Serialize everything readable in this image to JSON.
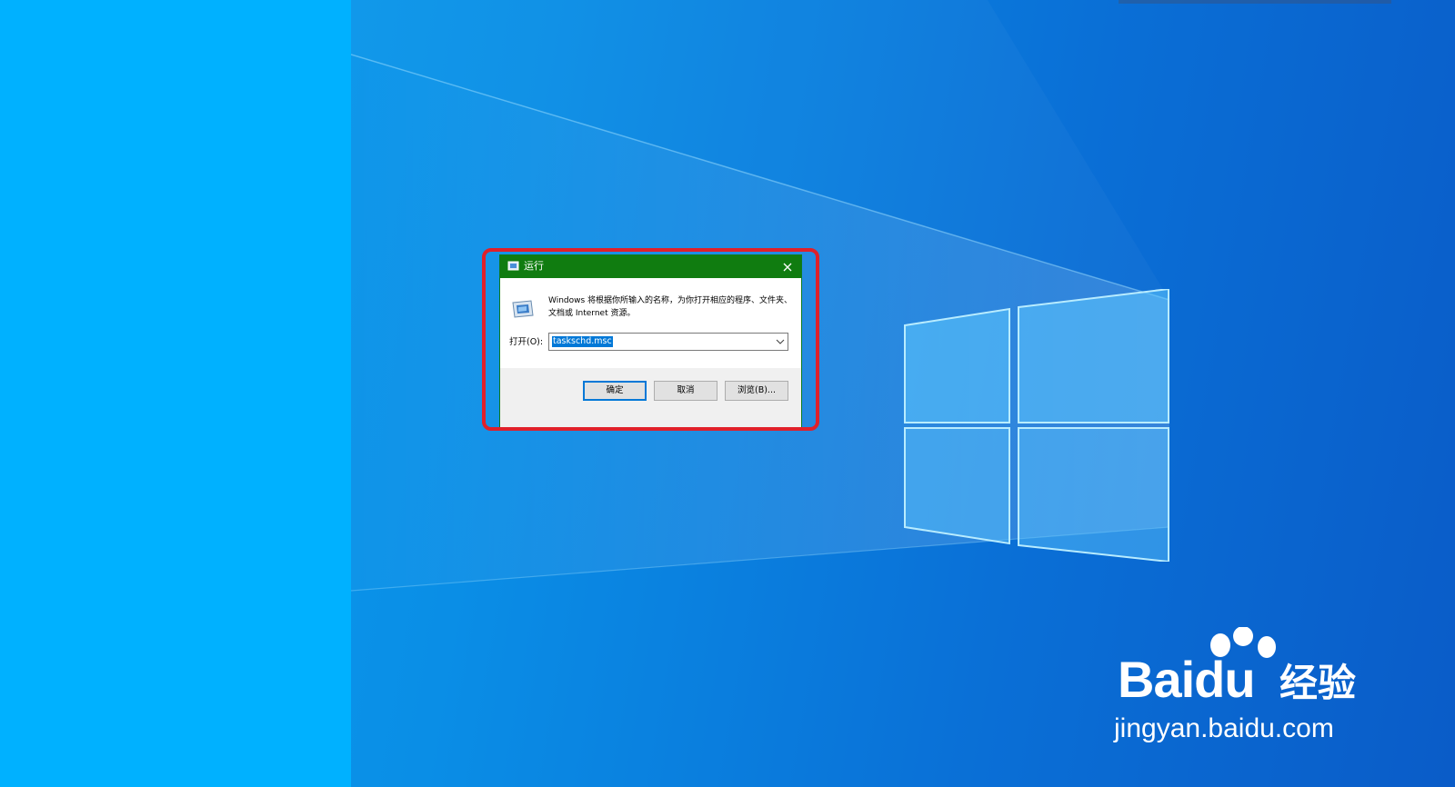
{
  "desktop": {
    "colors": {
      "left_pane": "#00b1ff",
      "wallpaper_base": "#0a8ee6",
      "logo_pane": "#7fd6ff"
    }
  },
  "run_dialog": {
    "title": "运行",
    "icon": "run-icon",
    "close_icon": "close-icon",
    "description": "Windows 将根据你所输入的名称，为你打开相应的程序、文件夹、文档或 Internet 资源。",
    "open_label": "打开(O):",
    "open_value": "taskschd.msc",
    "buttons": {
      "ok": "确定",
      "cancel": "取消",
      "browse": "浏览(B)..."
    },
    "colors": {
      "titlebar": "#107c10",
      "highlight_border": "#e0202a",
      "selection": "#0078d7"
    }
  },
  "watermark": {
    "logo_text_bai": "Bai",
    "logo_text_du": "du",
    "logo_text_cn": "经验",
    "url": "jingyan.baidu.com"
  }
}
